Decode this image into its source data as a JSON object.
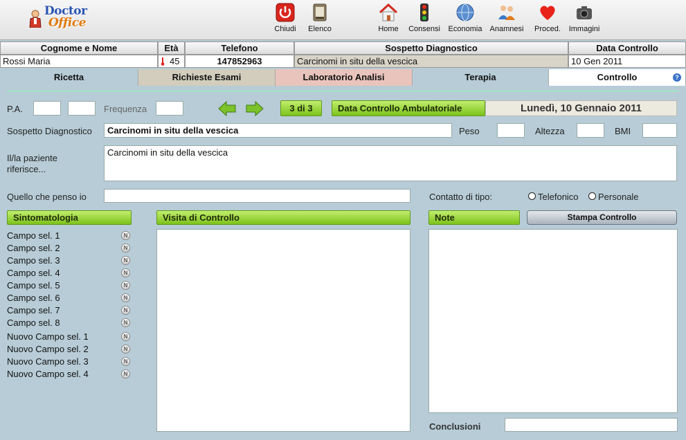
{
  "toolbar": {
    "logo_line1": "Doctor",
    "logo_line2": "Office",
    "buttons": [
      {
        "label": "Chiudi",
        "icon": "power-icon"
      },
      {
        "label": "Elenco",
        "icon": "list-icon"
      },
      {
        "label": "Home",
        "icon": "home-icon"
      },
      {
        "label": "Consensi",
        "icon": "traffic-light-icon"
      },
      {
        "label": "Economia",
        "icon": "globe-icon"
      },
      {
        "label": "Anamnesi",
        "icon": "people-icon"
      },
      {
        "label": "Proced.",
        "icon": "heart-icon"
      },
      {
        "label": "Immagini",
        "icon": "camera-icon"
      }
    ]
  },
  "patient": {
    "headers": {
      "name": "Cognome e Nome",
      "age": "Età",
      "phone": "Telefono",
      "diagnosis": "Sospetto Diagnostico",
      "date": "Data Controllo"
    },
    "name": "Rossi Maria",
    "age": "45",
    "phone": "147852963",
    "diagnosis": "Carcinomi in situ della vescica",
    "date": "10 Gen 2011"
  },
  "tabs": [
    {
      "label": "Ricetta",
      "color": "#b7ccd6"
    },
    {
      "label": "Richieste Esami",
      "color": "#d2cdbd"
    },
    {
      "label": "Laboratorio Analisi",
      "color": "#e9c4bc"
    },
    {
      "label": "Terapia",
      "color": "#b7ccd6"
    },
    {
      "label": "Controllo",
      "color": "#ffffff"
    }
  ],
  "help_icon": "help-icon",
  "form": {
    "pa_label": "P.A.",
    "freq_label": "Frequenza",
    "counter": "3 di 3",
    "date_title": "Data Controllo Ambulatoriale",
    "date_value": "Lunedì, 10 Gennaio 2011",
    "diag_label": "Sospetto Diagnostico",
    "diag_value": "Carcinomi in situ della vescica",
    "peso_label": "Peso",
    "altezza_label": "Altezza",
    "bmi_label": "BMI",
    "patient_reports_label_1": "Il/la paziente",
    "patient_reports_label_2": "riferisce...",
    "patient_reports_value": "Carcinomi in situ della vescica",
    "opinion_label": "Quello che penso io",
    "contact_label": "Contatto di tipo:",
    "contact_phone": "Telefonico",
    "contact_personal": "Personale",
    "symptoms_title": "Sintomatologia",
    "visit_title": "Visita di Controllo",
    "notes_title": "Note",
    "print_button": "Stampa Controllo",
    "conclusions_label": "Conclusioni",
    "symptoms": [
      "Campo sel. 1",
      "Campo sel. 2",
      "Campo sel. 3",
      "Campo sel. 4",
      "Campo sel. 5",
      "Campo sel. 6",
      "Campo sel. 7",
      "Campo sel. 8",
      "Nuovo Campo sel. 1",
      "Nuovo Campo sel. 2",
      "Nuovo Campo sel. 3",
      "Nuovo Campo sel. 4"
    ],
    "badge": "N"
  }
}
